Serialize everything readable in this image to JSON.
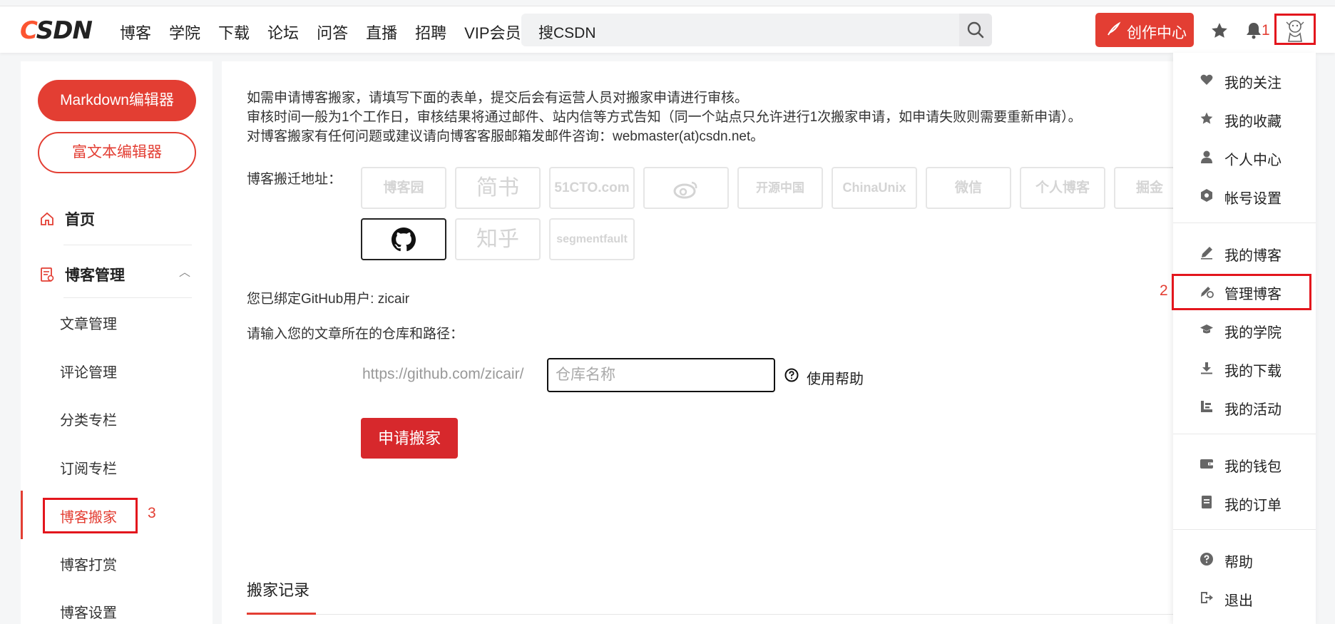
{
  "header": {
    "logo": "CSDN",
    "nav": [
      "博客",
      "学院",
      "下载",
      "论坛",
      "问答",
      "直播",
      "招聘",
      "VIP会员"
    ],
    "search_placeholder": "搜CSDN",
    "create_label": "创作中心",
    "step1": "1",
    "colors": {
      "brand": "#fc5531",
      "accent": "#e33e33"
    }
  },
  "sidebar": {
    "markdown_btn": "Markdown编辑器",
    "richtext_btn": "富文本编辑器",
    "home": "首页",
    "manage": "博客管理",
    "items": [
      "文章管理",
      "评论管理",
      "分类专栏",
      "订阅专栏",
      "博客搬家",
      "博客打赏",
      "博客设置"
    ],
    "step3": "3"
  },
  "main": {
    "intro": [
      "如需申请博客搬家，请填写下面的表单，提交后会有运营人员对搬家申请进行审核。",
      "审核时间一般为1个工作日，审核结果将通过邮件、站内信等方式告知（同一个站点只允许进行1次搬家申请，如申请失败则需要重新申请）。",
      "对博客搬家有任何问题或建议请向博客客服邮箱发邮件咨询：webmaster(at)csdn.net。"
    ],
    "address_label": "博客搬迁地址：",
    "platforms_row1": [
      "博客园",
      "简书",
      "51CTO.com",
      "新浪博客",
      "开源中国",
      "ChinaUnix",
      "微信",
      "个人博客",
      "掘金"
    ],
    "platforms_row2": [
      "GitHub",
      "知乎",
      "segmentfault"
    ],
    "bound_text": "您已绑定GitHub用户: zicair",
    "repo_label": "请输入您的文章所在的仓库和路径：",
    "repo_prefix": "https://github.com/zicair/",
    "repo_placeholder": "仓库名称",
    "help_label": "使用帮助",
    "apply_btn": "申请搬家",
    "record_title": "搬家记录"
  },
  "dropdown": {
    "group1": [
      "我的关注",
      "我的收藏",
      "个人中心",
      "帐号设置"
    ],
    "group2": [
      "我的博客",
      "管理博客",
      "我的学院",
      "我的下载",
      "我的活动"
    ],
    "group3": [
      "我的钱包",
      "我的订单"
    ],
    "group4": [
      "帮助",
      "退出"
    ],
    "step2": "2"
  }
}
